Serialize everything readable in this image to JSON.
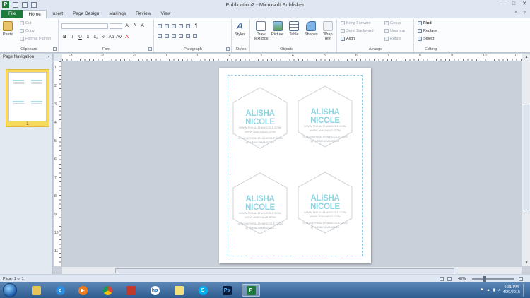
{
  "window": {
    "title": "Publication2 - Microsoft Publisher",
    "app_icon_letter": "P",
    "controls": [
      "–",
      "□",
      "✕"
    ]
  },
  "tabs": [
    "File",
    "Home",
    "Insert",
    "Page Design",
    "Mailings",
    "Review",
    "View"
  ],
  "ribbon": {
    "clipboard": {
      "paste": "Paste",
      "cut": "Cut",
      "copy": "Copy",
      "format_painter": "Format Painter",
      "label": "Clipboard"
    },
    "font": {
      "label": "Font",
      "bold": "B",
      "italic": "I",
      "underline": "U",
      "strike": "x",
      "subscript": "x₂",
      "superscript": "x²",
      "grow": "A",
      "shrink": "A",
      "clear": "A",
      "aa": "Aa",
      "spacing": "AV"
    },
    "paragraph": {
      "label": "Paragraph",
      "pilcrow": "¶"
    },
    "styles": {
      "btn": "Styles",
      "label": "Styles"
    },
    "objects": {
      "label": "Objects",
      "draw_text_box": "Draw Text Box",
      "picture": "Picture",
      "table": "Table",
      "shapes": "Shapes",
      "wrap_text": "Wrap Text"
    },
    "arrange": {
      "label": "Arrange",
      "bring_forward": "Bring Forward",
      "send_backward": "Send Backward",
      "align": "Align",
      "group": "Group",
      "ungroup": "Ungroup",
      "rotate": "Rotate"
    },
    "editing": {
      "label": "Editing",
      "find": "Find",
      "replace": "Replace",
      "select": "Select"
    }
  },
  "page_navigation": {
    "title": "Page Navigation",
    "page_number": "1"
  },
  "ruler_h_numbers": [
    "-3",
    "-2",
    "-1",
    "0",
    "1",
    "2",
    "3",
    "4",
    "5",
    "6",
    "7",
    "8",
    "9",
    "10",
    "11"
  ],
  "ruler_v_numbers": [
    "1",
    "2",
    "3",
    "4",
    "5",
    "6",
    "7",
    "8",
    "9",
    "10",
    "11"
  ],
  "cards": [
    {
      "name": "ALISHA NICOLE",
      "lines": [
        "WWW.THEALISHANICOLE.COM",
        "WWW.ANICHAUD.COM",
        "XOXO@THEALISHANICOLE.COM",
        "@THEALISHANICOLE"
      ]
    },
    {
      "name": "ALISHA NICOLE",
      "lines": [
        "WWW.THEALISHANICOLE.COM",
        "WWW.ANICHAUD.COM",
        "XOXO@THEALISHANICOLE.COM",
        "@THEALISHANICOLE"
      ]
    },
    {
      "name": "ALISHA NICOLE",
      "lines": [
        "WWW.THEALISHANICOLE.COM",
        "WWW.ANICHAUD.COM",
        "XOXO@THEALISHANICOLE.COM",
        "@THEALISHANICOLE"
      ]
    },
    {
      "name": "ALISHA NICOLE",
      "lines": [
        "WWW.THEALISHANICOLE.COM",
        "WWW.ANICHAUD.COM",
        "XOXO@THEALISHANICOLE.COM",
        "@THEALISHANICOLE"
      ]
    }
  ],
  "status": {
    "page": "Page: 1 of 1",
    "zoom": "48%"
  },
  "taskbar": {
    "time": "6:31 PM",
    "date": "4/20/2015",
    "photoshop_label": "Ps"
  },
  "colors": {
    "accent_green": "#1d7a3a",
    "card_teal": "#8ed3df",
    "nav_selected": "#f7d95c"
  }
}
